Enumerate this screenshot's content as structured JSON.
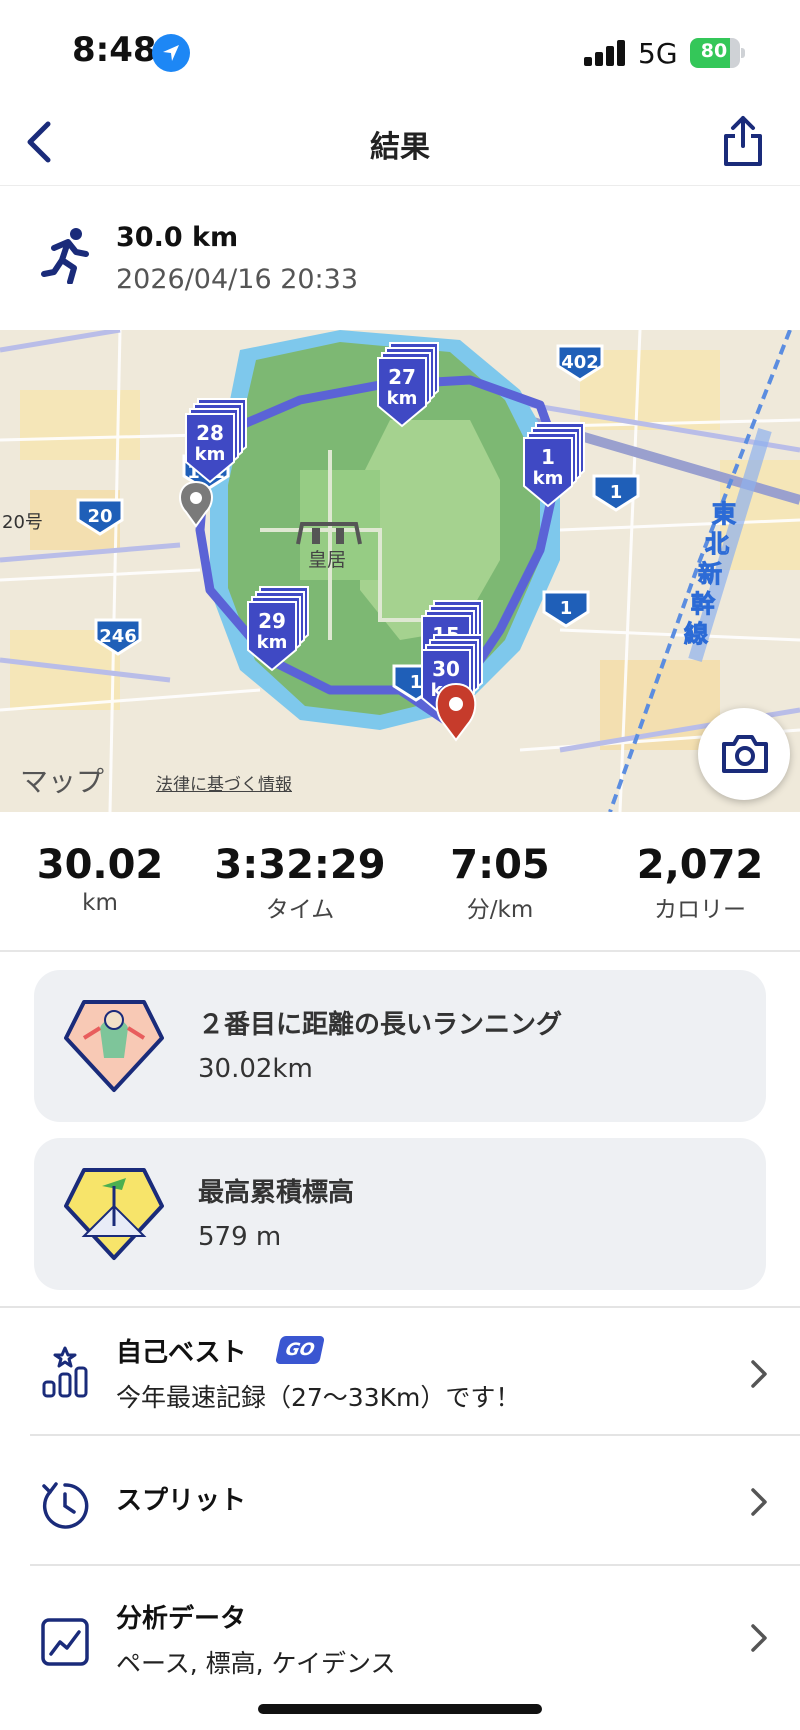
{
  "status_bar": {
    "time": "8:48",
    "network": "5G",
    "battery": "80",
    "battery_level": 0.8
  },
  "nav": {
    "title": "結果"
  },
  "activity": {
    "distance": "30.0 km",
    "datetime": "2026/04/16 20:33"
  },
  "map": {
    "attribution": "マップ",
    "legal": "法律に基づく情報",
    "place_label": "皇居",
    "road_label_20go": "20号",
    "rail_label": "東北新幹線",
    "km_markers": [
      "28",
      "27",
      "1",
      "29",
      "15",
      "30"
    ],
    "km_unit": "km",
    "route_shields": [
      "402",
      "20",
      "1",
      "1",
      "246",
      "1",
      "101"
    ]
  },
  "stats": [
    {
      "value": "30.02",
      "label": "km"
    },
    {
      "value": "3:32:29",
      "label": "タイム"
    },
    {
      "value": "7:05",
      "label": "分/km"
    },
    {
      "value": "2,072",
      "label": "カロリー"
    }
  ],
  "achievements": [
    {
      "title": "２番目に距離の長いランニング",
      "value": "30.02km"
    },
    {
      "title": "最高累積標高",
      "value": "579 m"
    }
  ],
  "rows": {
    "personal_best": {
      "title": "自己ベスト",
      "badge": "GO",
      "subtitle": "今年最速記録（27～33Km）です！"
    },
    "splits": {
      "title": "スプリット"
    },
    "analysis": {
      "title": "分析データ",
      "subtitle": "ペース, 標高, ケイデンス"
    }
  },
  "colors": {
    "accent": "#1a2b7a",
    "route": "#5b63d6",
    "marker": "#3f49c4",
    "end_pin": "#c63b2b",
    "card_bg": "#eef0f3"
  }
}
